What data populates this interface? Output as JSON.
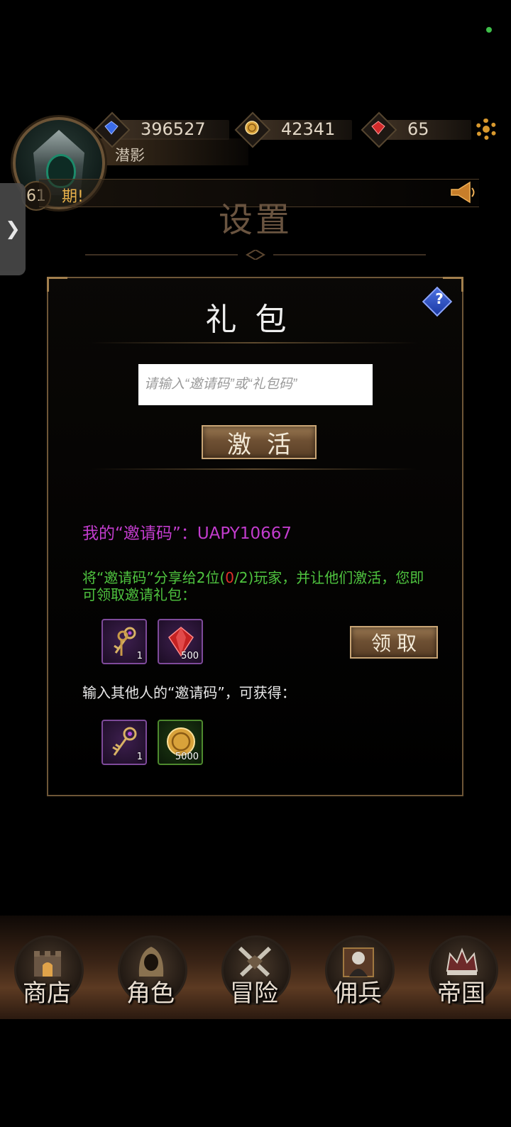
{
  "player": {
    "name": "潜影",
    "level": "61",
    "resources": [
      {
        "icon": "blue-gem-icon",
        "value": "396527",
        "color": "#3a6be8"
      },
      {
        "icon": "gold-coin-icon",
        "value": "42341",
        "color": "#d9a23a"
      },
      {
        "icon": "red-gem-icon",
        "value": "65",
        "color": "#d12a2a"
      }
    ],
    "news_text": "期!"
  },
  "page": {
    "title": "设置"
  },
  "gift_panel": {
    "title": "礼包",
    "input_placeholder": "请输入“邀请码”或“礼包码”",
    "input_value": "",
    "activate_label": "激活",
    "my_code_text": "我的“邀请码”：UAPY10667",
    "share_text_before": "将“邀请码”分享给2位(",
    "share_progress": "0",
    "share_text_after": "/2)玩家，并让他们激活，您即可领取邀请礼包：",
    "invite_rewards": [
      {
        "icon": "keys-icon",
        "qty": "1"
      },
      {
        "icon": "red-gem-icon",
        "qty": "500"
      }
    ],
    "claim_label": "领取",
    "enter_text": "输入其他人的“邀请码”，可获得：",
    "enter_rewards": [
      {
        "icon": "key-icon",
        "qty": "1"
      },
      {
        "icon": "gold-coin-icon",
        "qty": "5000"
      }
    ],
    "colors": {
      "my_code": "#c23ccd",
      "share": "#4fc43f",
      "progress": "#e0302a"
    }
  },
  "nav": [
    {
      "label": "商店",
      "icon": "castle-icon"
    },
    {
      "label": "角色",
      "icon": "hooded-figure-icon"
    },
    {
      "label": "冒险",
      "icon": "crossed-swords-icon"
    },
    {
      "label": "佣兵",
      "icon": "mercenary-icon"
    },
    {
      "label": "帝国",
      "icon": "crown-icon"
    }
  ]
}
